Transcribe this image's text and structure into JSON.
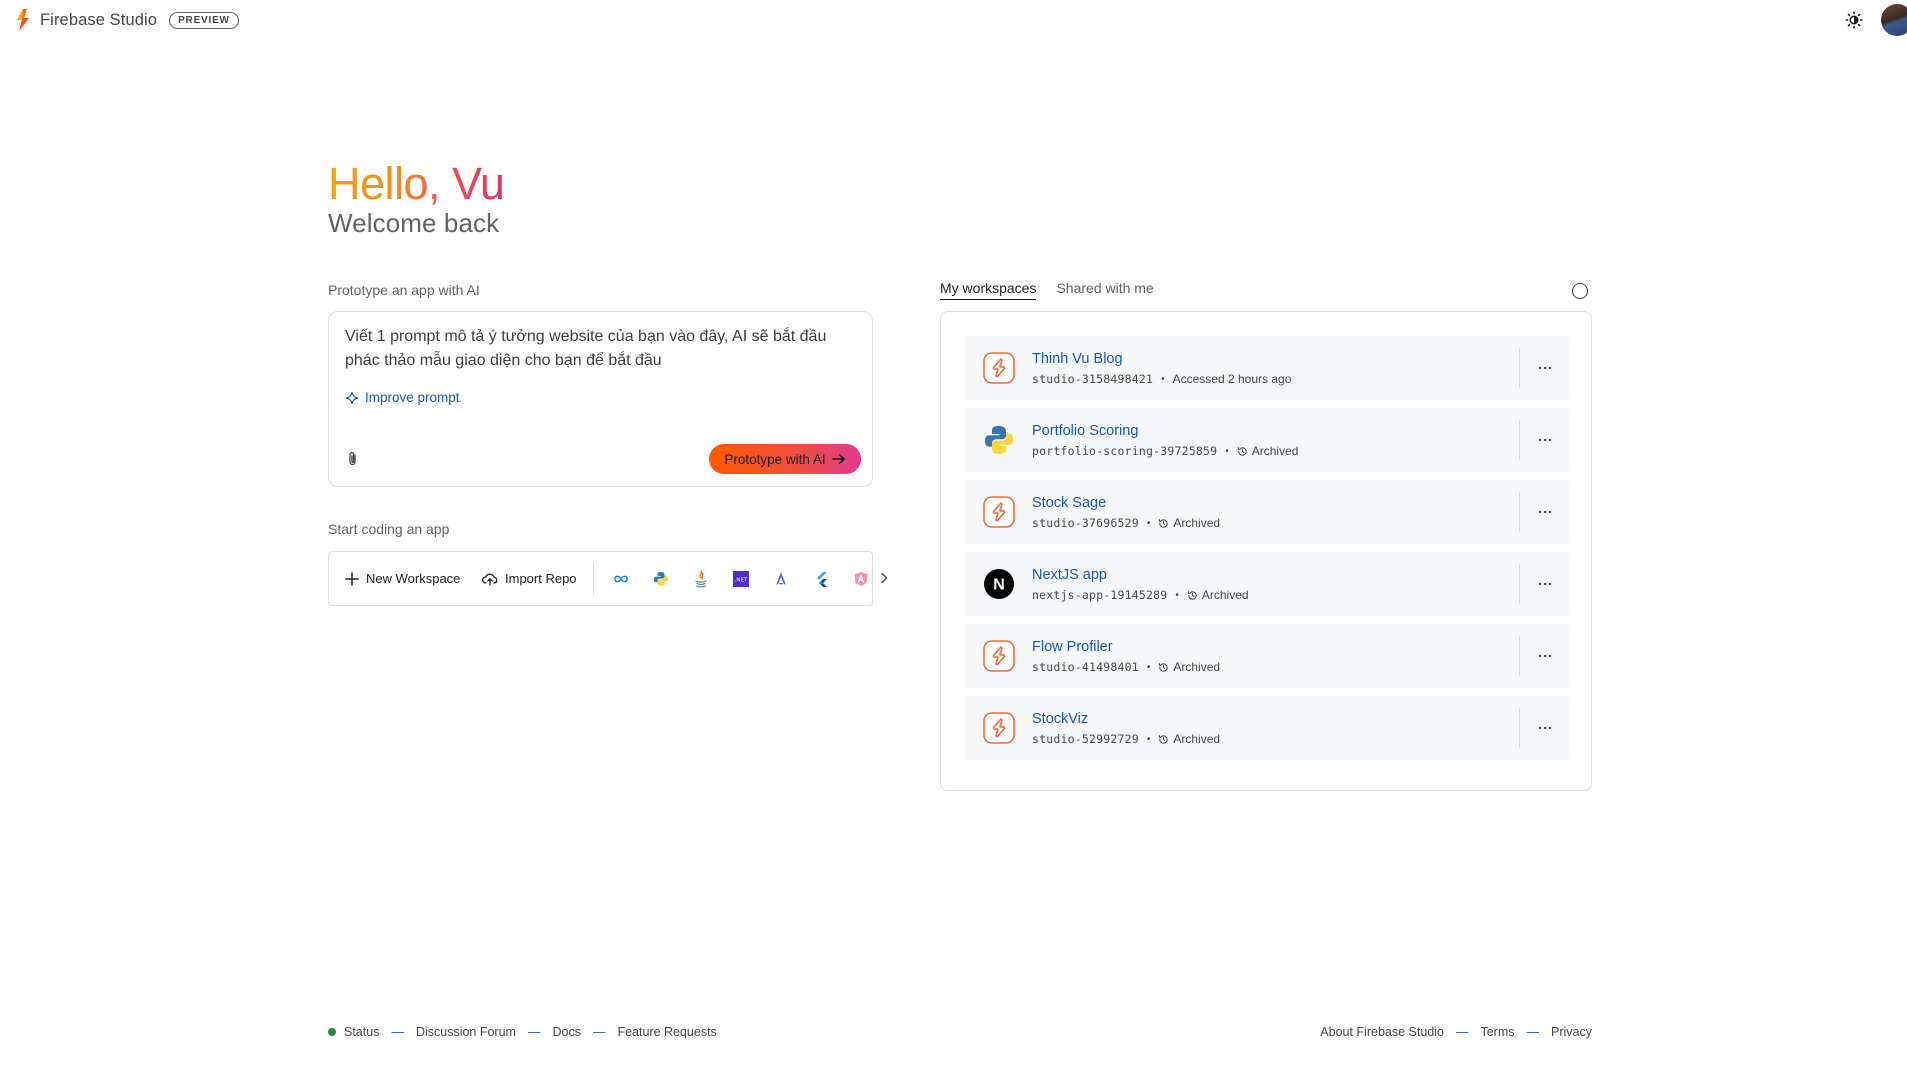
{
  "header": {
    "brand_name": "Firebase Studio",
    "badge": "PREVIEW",
    "theme_icon": "sun-icon"
  },
  "greeting": {
    "hello": "Hello, Vu",
    "welcome": "Welcome back"
  },
  "prototype": {
    "label": "Prototype an app with AI",
    "prompt_text": "Viết 1 prompt mô tả ý tưởng website của bạn vào đây, AI sẽ bắt đầu phác thảo mẫu giao diện cho bạn để bắt đầu",
    "improve_label": "Improve prompt",
    "button_label": "Prototype with AI"
  },
  "coding": {
    "label": "Start coding an app",
    "new_workspace": "New Workspace",
    "import_repo": "Import Repo",
    "templates": [
      "infinity-icon",
      "python-icon",
      "java-icon",
      "dotnet-icon",
      "astro-icon",
      "flutter-icon",
      "angular-icon"
    ],
    "dotnet_text": ".NET"
  },
  "workspaces": {
    "tabs": [
      "My workspaces",
      "Shared with me"
    ],
    "items": [
      {
        "name": "Thinh Vu Blog",
        "id": "studio-3158498421",
        "status": "Accessed 2 hours ago",
        "icon": "studio-icon",
        "archived": false
      },
      {
        "name": "Portfolio Scoring",
        "id": "portfolio-scoring-39725859",
        "status": "Archived",
        "icon": "python-icon",
        "archived": true
      },
      {
        "name": "Stock Sage",
        "id": "studio-37696529",
        "status": "Archived",
        "icon": "studio-icon",
        "archived": true
      },
      {
        "name": "NextJS app",
        "id": "nextjs-app-19145289",
        "status": "Archived",
        "icon": "nextjs-icon",
        "archived": true
      },
      {
        "name": "Flow Profiler",
        "id": "studio-41498401",
        "status": "Archived",
        "icon": "studio-icon",
        "archived": true
      },
      {
        "name": "StockViz",
        "id": "studio-52992729",
        "status": "Archived",
        "icon": "studio-icon",
        "archived": true
      }
    ],
    "nextjs_letter": "N"
  },
  "footer": {
    "left": [
      "Status",
      "Discussion Forum",
      "Docs",
      "Feature Requests"
    ],
    "right": [
      "About Firebase Studio",
      "Terms",
      "Privacy"
    ],
    "separator": "—"
  },
  "colors": {
    "accent_link": "#1a56b8",
    "gradient_start": "#fe5a00",
    "gradient_end": "#e23a8f",
    "status_green": "#1e8e3e"
  }
}
